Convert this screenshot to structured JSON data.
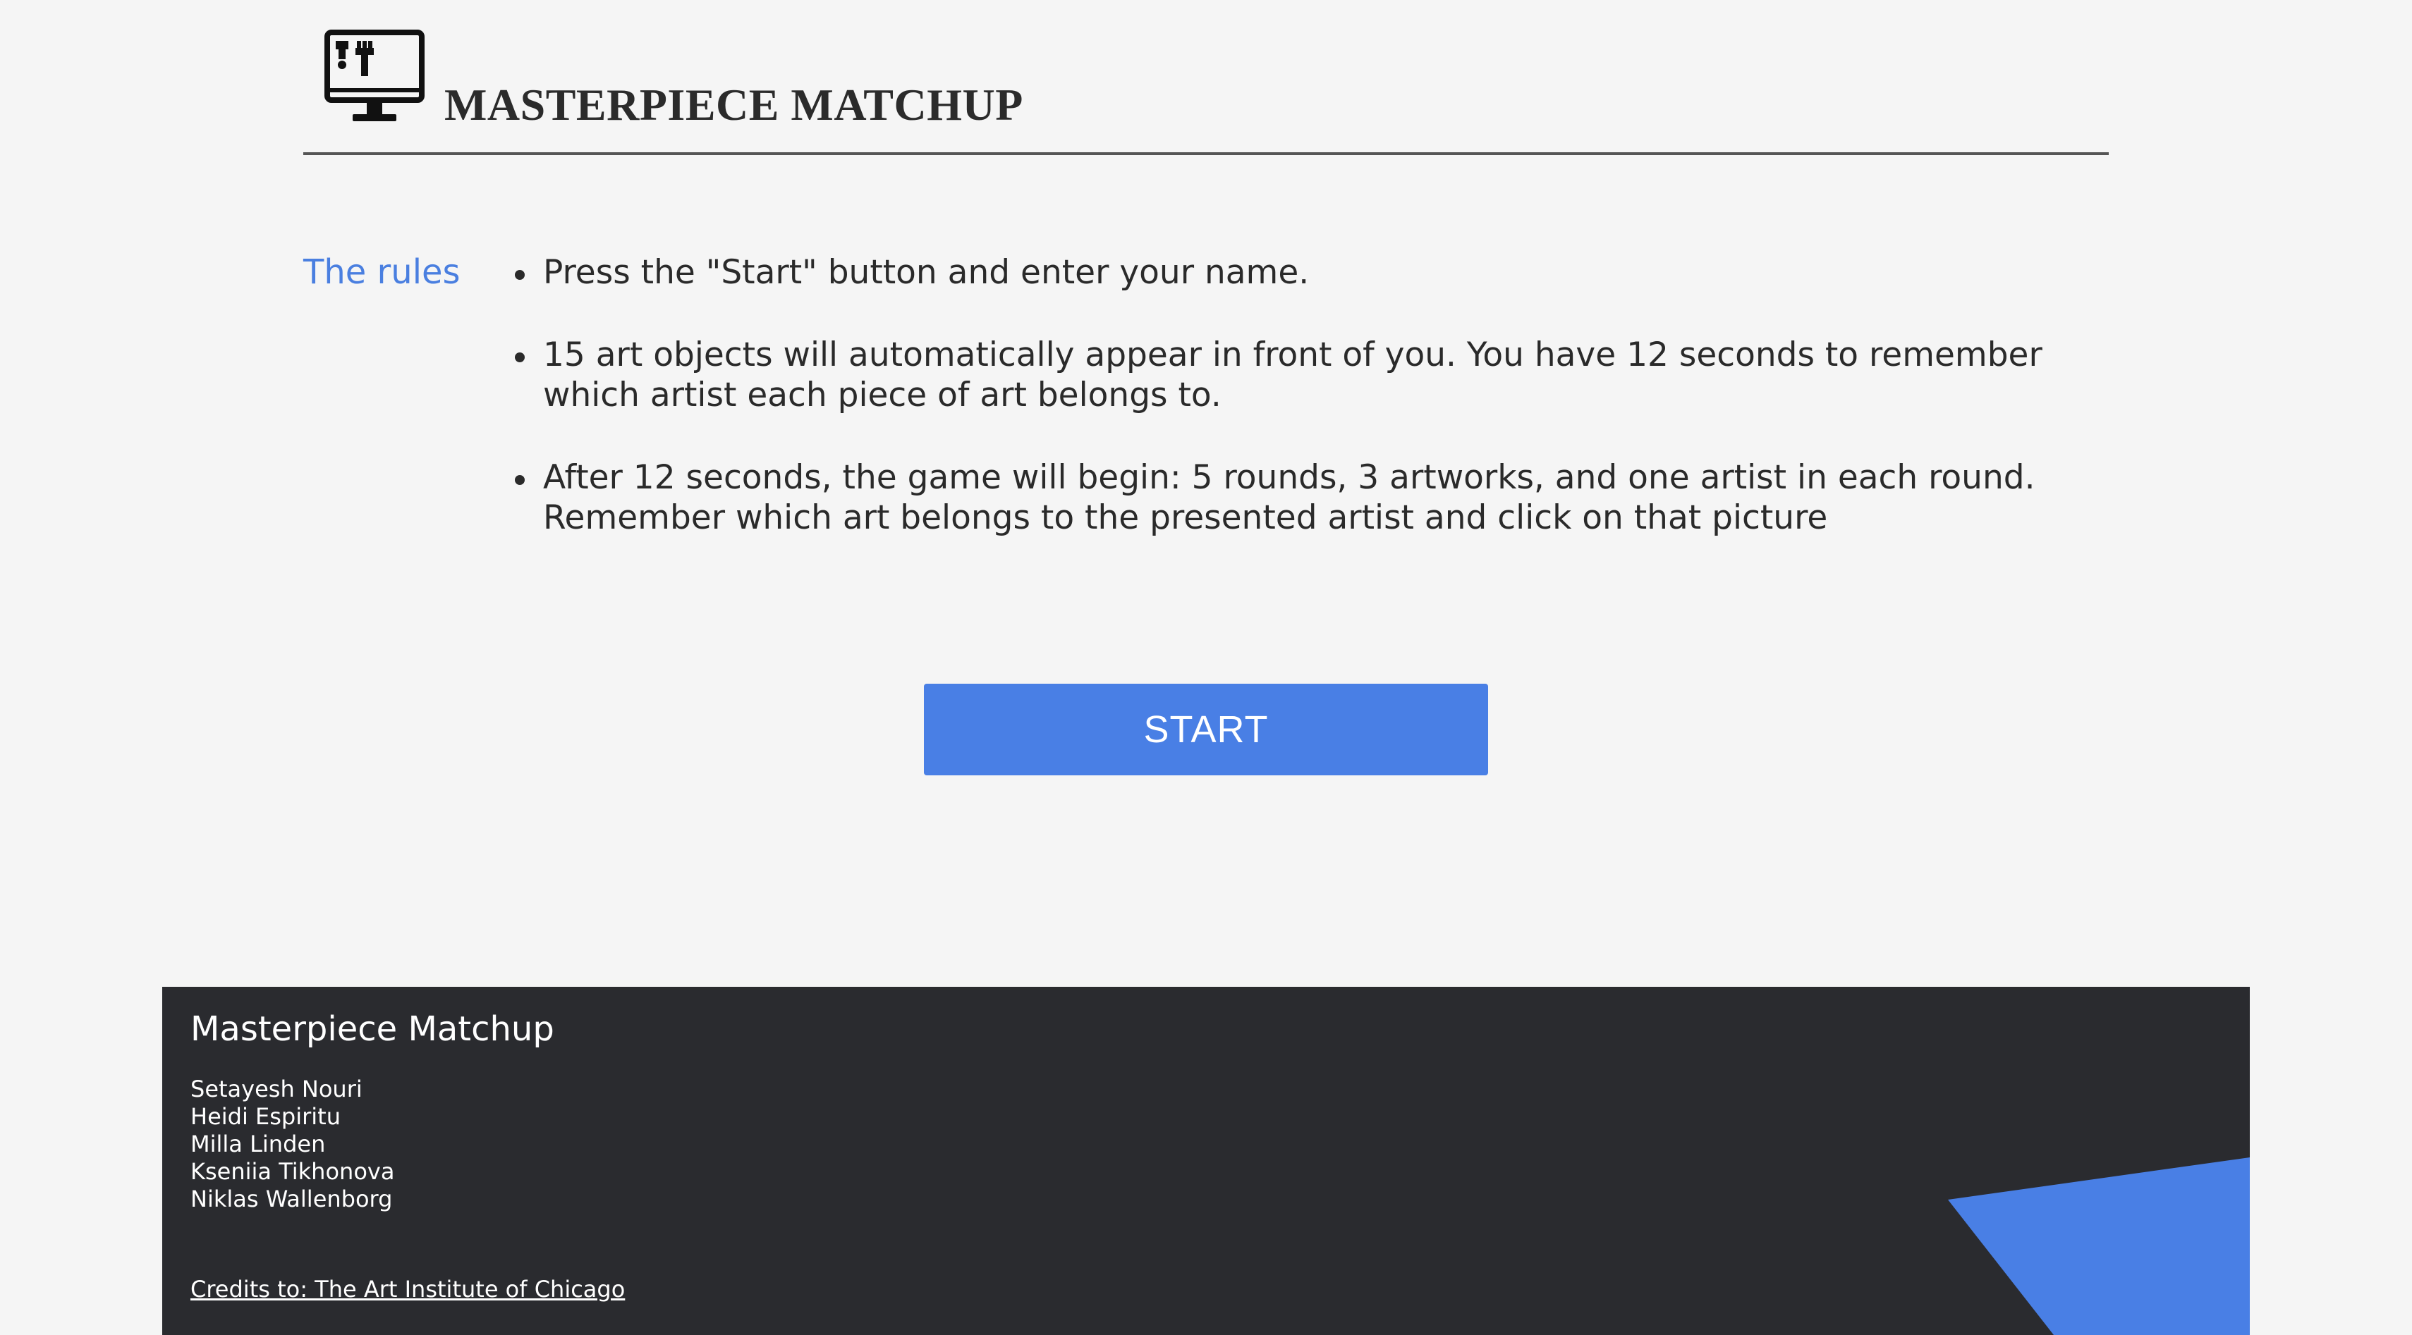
{
  "header": {
    "title": "MASTERPIECE MATCHUP",
    "logo_icon": "monitor-paintbrush-icon"
  },
  "rules": {
    "label": "The rules",
    "items": [
      "Press the \"Start\" button and enter your name.",
      "15 art objects will automatically appear in front of you. You have 12 seconds to remember which artist each piece of art belongs to.",
      "After 12 seconds, the game will begin: 5 rounds, 3 artworks, and one artist in each round. Remember which art belongs to the presented artist and click on that picture"
    ]
  },
  "start_button": {
    "label": "START"
  },
  "footer": {
    "title": "Masterpiece Matchup",
    "authors": [
      "Setayesh Nouri",
      "Heidi Espiritu",
      "Milla Linden",
      "Kseniia Tikhonova",
      "Niklas Wallenborg"
    ],
    "credits": "Credits to: The Art Institute of Chicago"
  },
  "colors": {
    "background": "#f5f5f5",
    "accent": "#497fe5",
    "link": "#4a7fe0",
    "footer_background": "#2a2b2f",
    "text": "#2a2a2a"
  }
}
